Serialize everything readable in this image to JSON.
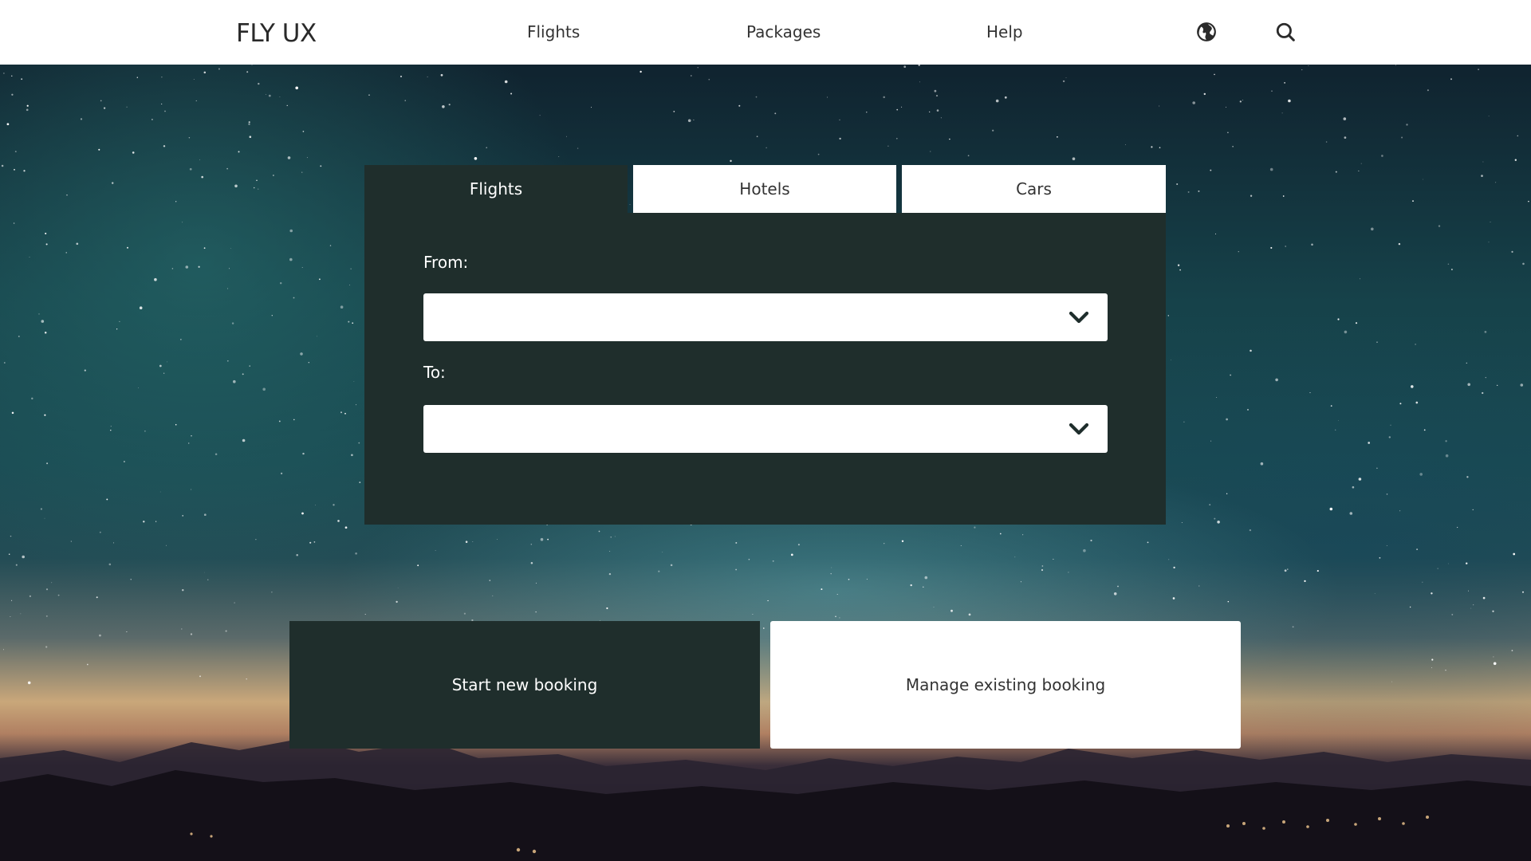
{
  "header": {
    "logo": "FLY UX",
    "nav": {
      "flights": "Flights",
      "packages": "Packages",
      "help": "Help"
    },
    "icons": [
      "globe-icon",
      "search-icon"
    ]
  },
  "booking": {
    "tabs": {
      "flights": "Flights",
      "hotels": "Hotels",
      "cars": "Cars"
    },
    "active_tab": "Flights",
    "from_label": "From:",
    "to_label": "To:",
    "from_value": "",
    "to_value": ""
  },
  "actions": {
    "start": "Start new booking",
    "manage": "Manage existing booking"
  },
  "colors": {
    "panel": "#1f2e2c",
    "header": "#ffffff",
    "text_light": "#ffffff",
    "text_dark": "#333333"
  }
}
